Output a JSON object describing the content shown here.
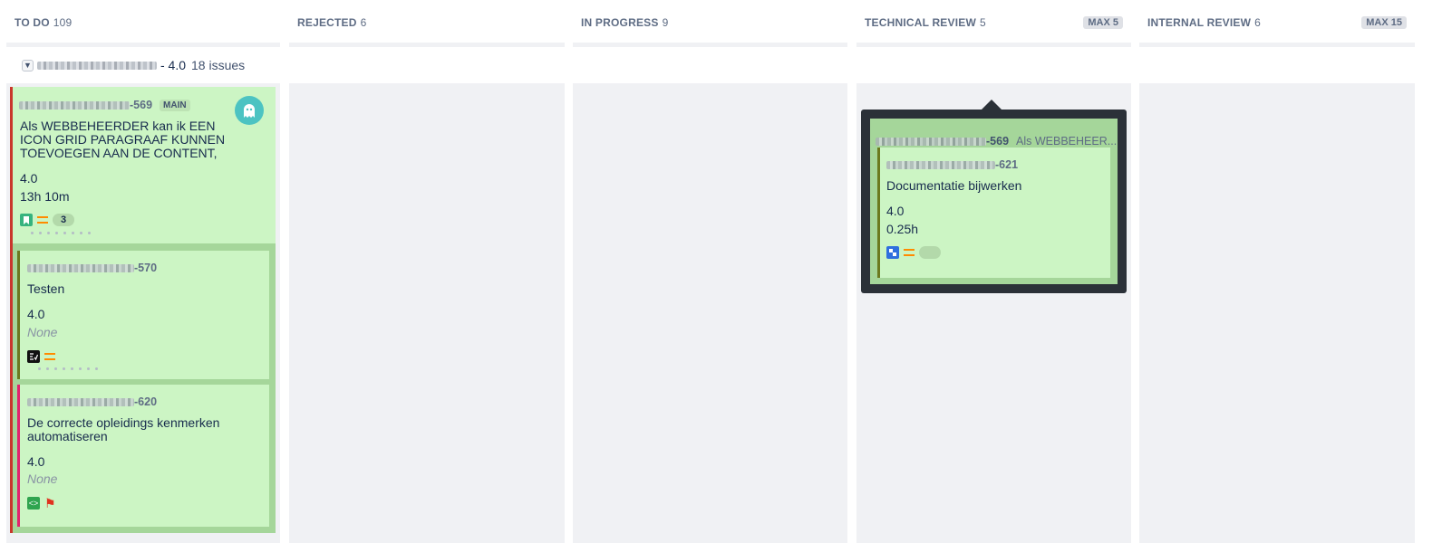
{
  "columns": [
    {
      "name": "TO DO",
      "count": "109",
      "max": ""
    },
    {
      "name": "REJECTED",
      "count": "6",
      "max": ""
    },
    {
      "name": "IN PROGRESS",
      "count": "9",
      "max": ""
    },
    {
      "name": "TECHNICAL REVIEW",
      "count": "5",
      "max": "MAX 5"
    },
    {
      "name": "INTERNAL REVIEW",
      "count": "6",
      "max": "MAX 15"
    }
  ],
  "swimlane": {
    "version": "- 4.0",
    "issues": "18 issues"
  },
  "cards": {
    "main": {
      "key": "-569",
      "tag": "MAIN",
      "summary": "Als WEBBEHEERDER kan ik EEN ICON GRID PARAGRAAF KUNNEN TOEVOEGEN AAN DE CONTENT,",
      "version": "4.0",
      "estimate": "13h 10m",
      "subtask_count": "3",
      "issue_type_icon": "story-icon",
      "priority_icon": "priority-medium-icon",
      "avatar_icon": "ghost-avatar-icon"
    },
    "sub570": {
      "key": "-570",
      "summary": "Testen",
      "version": "4.0",
      "estimate": "None",
      "issue_type_icon": "subtask-icon",
      "priority_icon": "priority-medium-icon"
    },
    "sub620": {
      "key": "-620",
      "summary": "De correcte opleidings kenmerken automatiseren",
      "version": "4.0",
      "estimate": "None",
      "issue_type_icon": "code-icon",
      "priority_icon": "flag-icon"
    }
  },
  "popup": {
    "parent_key": "-569",
    "parent_title": "Als WEBBEHEER...",
    "card": {
      "key": "-621",
      "summary": "Documentatie bijwerken",
      "version": "4.0",
      "estimate": "0.25h",
      "issue_type_icon": "task-icon",
      "priority_icon": "priority-medium-icon"
    }
  },
  "colors": {
    "card_bg": "#ccf5c4",
    "subtask_group_bg": "#a5d69a",
    "column_bg": "#f0f1f4",
    "popup_bg": "#2b3138",
    "epic_red": "#c9372c",
    "sub570_border": "#6b7a1f",
    "sub620_border": "#e2246d",
    "priority_orange": "#ff8b00",
    "avatar_teal": "#4cc3c2"
  }
}
